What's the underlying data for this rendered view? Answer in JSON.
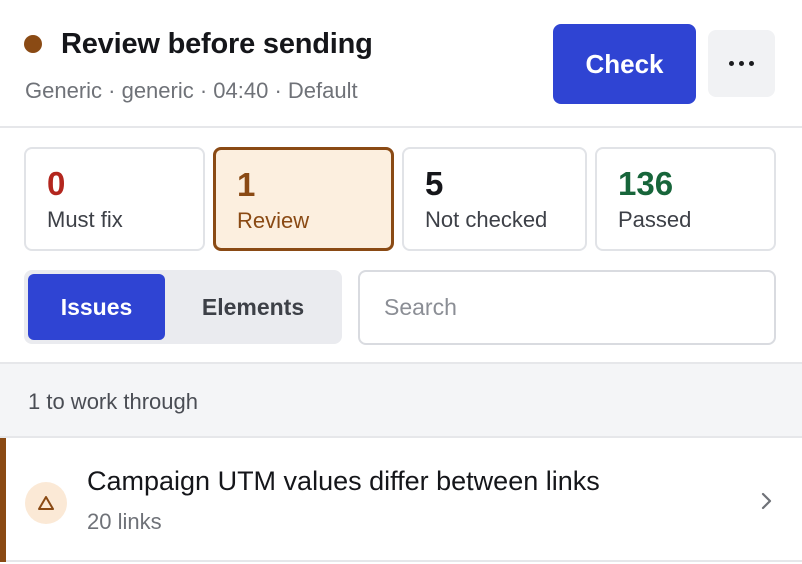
{
  "header": {
    "title": "Review before sending",
    "subtitle": "Generic · generic · 04:40 · Default",
    "check_label": "Check",
    "status_color": "#8a4a14"
  },
  "stats": [
    {
      "value": "0",
      "label": "Must fix",
      "color": "#b3261e"
    },
    {
      "value": "1",
      "label": "Review",
      "color": "#8a4a14"
    },
    {
      "value": "5",
      "label": "Not checked",
      "color": "#15161a"
    },
    {
      "value": "136",
      "label": "Passed",
      "color": "#17653a"
    }
  ],
  "tabs": [
    {
      "label": "Issues",
      "active": true
    },
    {
      "label": "Elements",
      "active": false
    }
  ],
  "search": {
    "placeholder": "Search",
    "value": ""
  },
  "group": {
    "label": "1 to work through"
  },
  "issues": [
    {
      "title": "Campaign UTM values differ between links",
      "subtitle": "20 links",
      "icon": "warning-triangle-icon"
    }
  ],
  "colors": {
    "accent": "#2f44d3",
    "review": "#8a4a14"
  }
}
